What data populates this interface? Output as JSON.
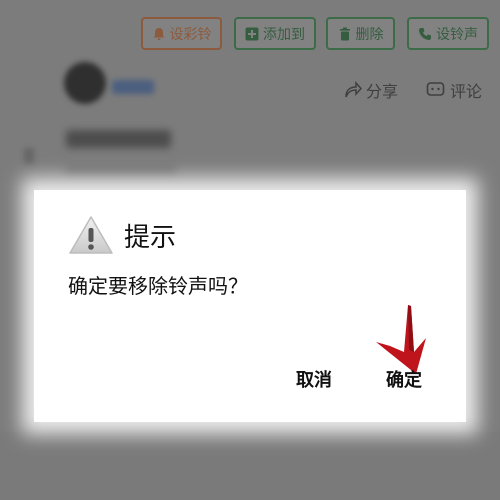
{
  "toolbar": {
    "ringtone_label": "设彩铃",
    "add_label": "添加到",
    "delete_label": "删除",
    "set_ring_label": "设铃声"
  },
  "actions": {
    "share_label": "分享",
    "comment_label": "评论"
  },
  "dialog": {
    "title": "提示",
    "message": "确定要移除铃声吗？",
    "cancel_label": "取消",
    "confirm_label": "确定"
  },
  "colors": {
    "accent_orange": "#8c5a3c",
    "accent_green": "#3b6c47",
    "annotation_arrow": "#c0141c"
  },
  "icons": [
    "bell-icon",
    "plus-square-icon",
    "trash-icon",
    "phone-icon",
    "share-icon",
    "comment-icon",
    "warning-icon"
  ]
}
